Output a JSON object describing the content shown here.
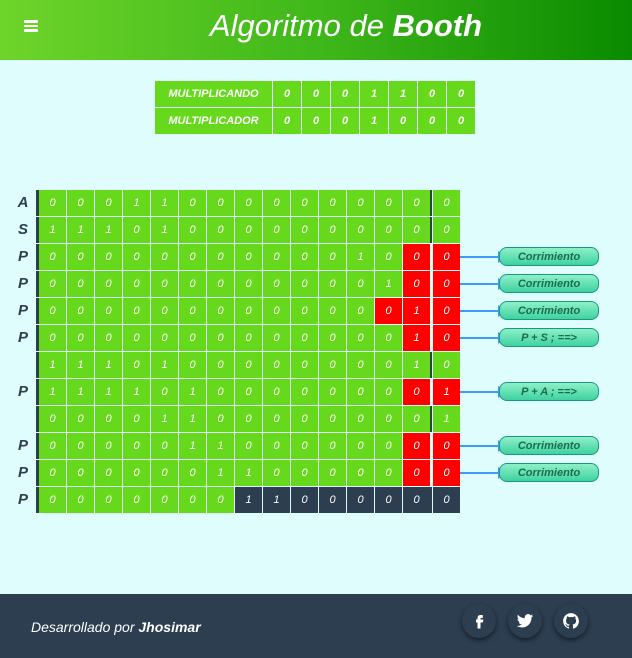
{
  "header": {
    "title_light": "Algoritmo de ",
    "title_bold": "Booth"
  },
  "inputs": [
    {
      "label": "MULTIPLICANDO",
      "bits": [
        "0",
        "0",
        "0",
        "1",
        "1",
        "0",
        "0"
      ]
    },
    {
      "label": "MULTIPLICADOR",
      "bits": [
        "0",
        "0",
        "0",
        "1",
        "0",
        "0",
        "0"
      ]
    }
  ],
  "grid": [
    {
      "label": "A",
      "cells": [
        "0",
        "0",
        "0",
        "1",
        "1",
        "0",
        "0",
        "0",
        "0",
        "0",
        "0",
        "0",
        "0",
        "0",
        "0"
      ],
      "colors": "ggggggggggggggg",
      "sep": true,
      "op": ""
    },
    {
      "label": "S",
      "cells": [
        "1",
        "1",
        "1",
        "0",
        "1",
        "0",
        "0",
        "0",
        "0",
        "0",
        "0",
        "0",
        "0",
        "0",
        "0"
      ],
      "colors": "ggggggggggggggg",
      "sep": true,
      "op": ""
    },
    {
      "label": "P",
      "cells": [
        "0",
        "0",
        "0",
        "0",
        "0",
        "0",
        "0",
        "0",
        "0",
        "0",
        "0",
        "1",
        "0",
        "0",
        "0"
      ],
      "colors": "gggggggggggggrr",
      "sep": false,
      "op": "Corrimiento"
    },
    {
      "label": "P",
      "cells": [
        "0",
        "0",
        "0",
        "0",
        "0",
        "0",
        "0",
        "0",
        "0",
        "0",
        "0",
        "0",
        "1",
        "0",
        "0"
      ],
      "colors": "gggggggggggggrr",
      "sep": false,
      "op": "Corrimiento"
    },
    {
      "label": "P",
      "cells": [
        "0",
        "0",
        "0",
        "0",
        "0",
        "0",
        "0",
        "0",
        "0",
        "0",
        "0",
        "0",
        "0",
        "1",
        "0"
      ],
      "colors": "ggggggggggggrrr",
      "sep": false,
      "op": "Corrimiento"
    },
    {
      "label": "P",
      "cells": [
        "0",
        "0",
        "0",
        "0",
        "0",
        "0",
        "0",
        "0",
        "0",
        "0",
        "0",
        "0",
        "0",
        "1",
        "0"
      ],
      "colors": "gggggggggggggrr",
      "sep": false,
      "op": "P + S ; ==>"
    },
    {
      "label": "",
      "cells": [
        "1",
        "1",
        "1",
        "0",
        "1",
        "0",
        "0",
        "0",
        "0",
        "0",
        "0",
        "0",
        "0",
        "1",
        "0"
      ],
      "colors": "ggggggggggggggg",
      "sep": true,
      "op": ""
    },
    {
      "label": "P",
      "cells": [
        "1",
        "1",
        "1",
        "1",
        "0",
        "1",
        "0",
        "0",
        "0",
        "0",
        "0",
        "0",
        "0",
        "0",
        "1"
      ],
      "colors": "gggggggggggggrr",
      "sep": false,
      "op": "P + A ; ==>"
    },
    {
      "label": "",
      "cells": [
        "0",
        "0",
        "0",
        "0",
        "1",
        "1",
        "0",
        "0",
        "0",
        "0",
        "0",
        "0",
        "0",
        "0",
        "1"
      ],
      "colors": "ggggggggggggggg",
      "sep": true,
      "op": ""
    },
    {
      "label": "P",
      "cells": [
        "0",
        "0",
        "0",
        "0",
        "0",
        "1",
        "1",
        "0",
        "0",
        "0",
        "0",
        "0",
        "0",
        "0",
        "0"
      ],
      "colors": "gggggggggggggrr",
      "sep": false,
      "op": "Corrimiento"
    },
    {
      "label": "P",
      "cells": [
        "0",
        "0",
        "0",
        "0",
        "0",
        "0",
        "1",
        "1",
        "0",
        "0",
        "0",
        "0",
        "0",
        "0",
        "0"
      ],
      "colors": "gggggggggggggrr",
      "sep": false,
      "op": "Corrimiento"
    },
    {
      "label": "P",
      "cells": [
        "0",
        "0",
        "0",
        "0",
        "0",
        "0",
        "0",
        "1",
        "1",
        "0",
        "0",
        "0",
        "0",
        "0",
        "0"
      ],
      "colors": "gggggggddddddddg",
      "sep": true,
      "op": ""
    }
  ],
  "footer": {
    "credit_prefix": "Desarrollado por ",
    "credit_name": "Jhosimar"
  },
  "social": [
    {
      "name": "facebook-icon",
      "glyph": "f"
    },
    {
      "name": "twitter-icon",
      "glyph": "t"
    },
    {
      "name": "github-icon",
      "glyph": "g"
    }
  ],
  "colors": {
    "green": "#66d91c",
    "red": "#ff0000",
    "dark": "#2c3e50",
    "background": "#e0fdfd"
  }
}
